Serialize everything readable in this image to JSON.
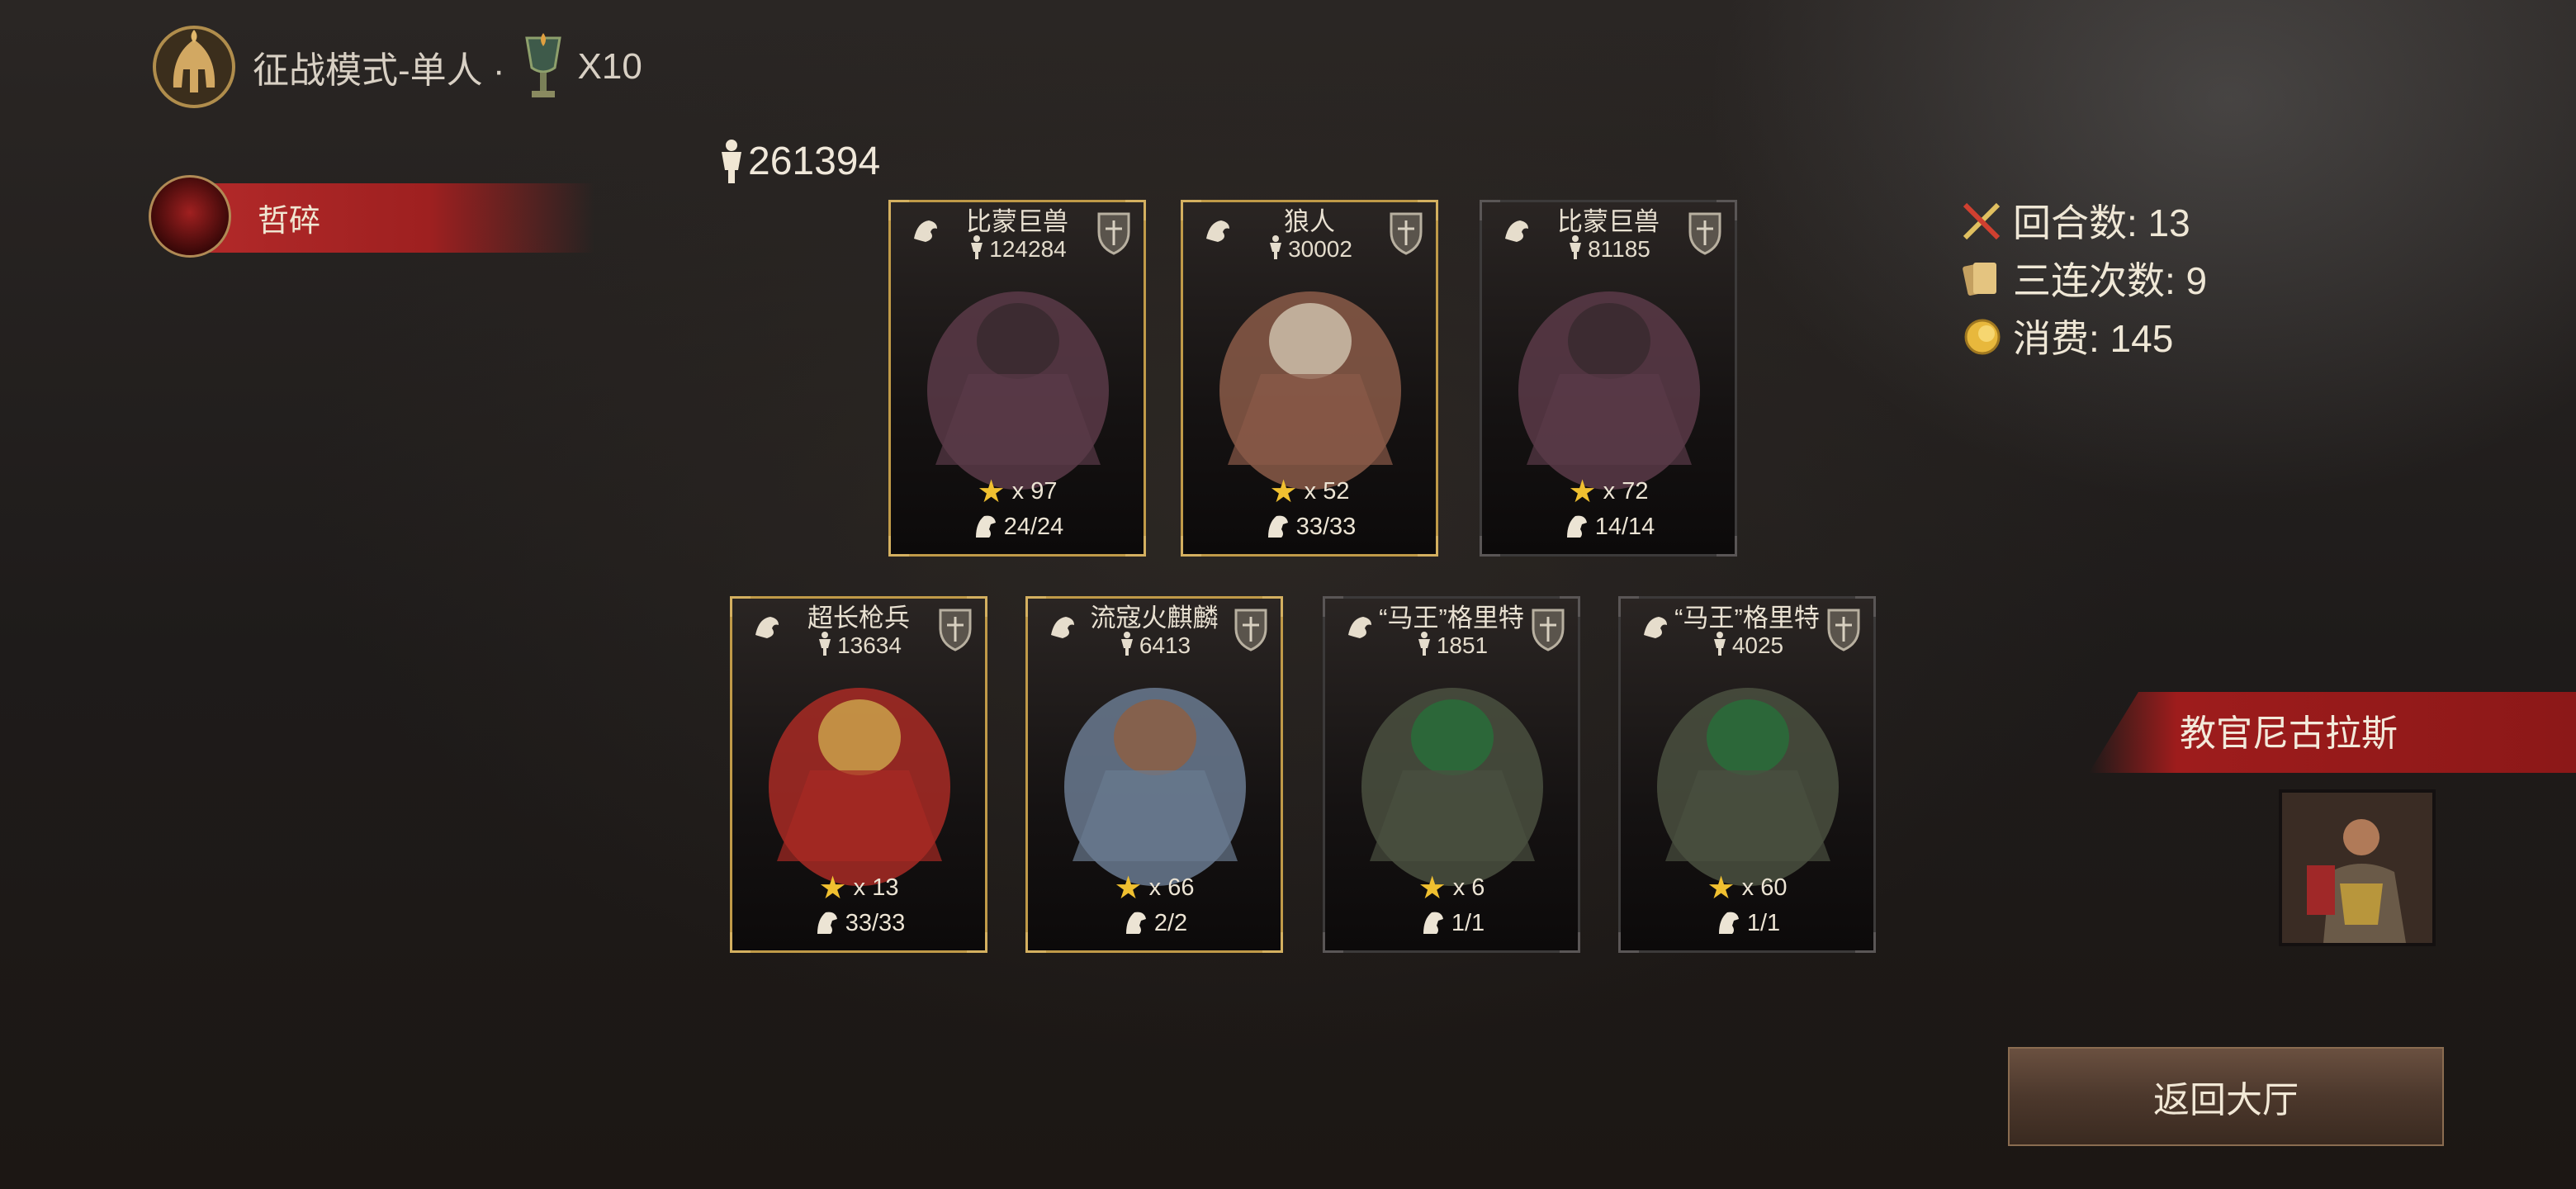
{
  "header": {
    "mode_label": "征战模式-单人 ·",
    "multiplier": "X10"
  },
  "defeat_badge": {
    "label": "哲碎"
  },
  "total_power": "261394",
  "cards": [
    {
      "name": "比蒙巨兽",
      "power": "124284",
      "stars": "x 97",
      "troops": "24/24",
      "frame": "gold",
      "type_icon": "beast-type-icon",
      "rank_icon": "shield-rank-icon"
    },
    {
      "name": "狼人",
      "power": "30002",
      "stars": "x 52",
      "troops": "33/33",
      "frame": "gold",
      "type_icon": "beast-type-icon",
      "rank_icon": "shield-rank-icon"
    },
    {
      "name": "比蒙巨兽",
      "power": "81185",
      "stars": "x 72",
      "troops": "14/14",
      "frame": "grey",
      "type_icon": "beast-type-icon",
      "rank_icon": "shield-rank-icon"
    },
    {
      "name": "超长枪兵",
      "power": "13634",
      "stars": "x 13",
      "troops": "33/33",
      "frame": "gold",
      "type_icon": "beast-type-icon",
      "rank_icon": "shield-rank-icon"
    },
    {
      "name": "流寇火麒麟",
      "power": "6413",
      "stars": "x 66",
      "troops": "2/2",
      "frame": "gold",
      "type_icon": "horse-type-icon",
      "rank_icon": "crest-rank-icon"
    },
    {
      "name": "“马王”格里特",
      "power": "1851",
      "stars": "x 6",
      "troops": "1/1",
      "frame": "grey",
      "type_icon": "horse-type-icon",
      "rank_icon": "crest-rank-icon"
    },
    {
      "name": "“马王”格里特",
      "power": "4025",
      "stars": "x 60",
      "troops": "1/1",
      "frame": "grey",
      "type_icon": "horse-type-icon",
      "rank_icon": "crest-rank-icon"
    }
  ],
  "stats": {
    "rounds": "回合数: 13",
    "triples": "三连次数: 9",
    "cost": "消费: 145"
  },
  "mentor": {
    "name": "教官尼古拉斯"
  },
  "return_button": {
    "label": "返回大厅"
  },
  "colors": {
    "gold": "#c09a48",
    "red": "#9e1c1c",
    "button": "#4c382c"
  }
}
